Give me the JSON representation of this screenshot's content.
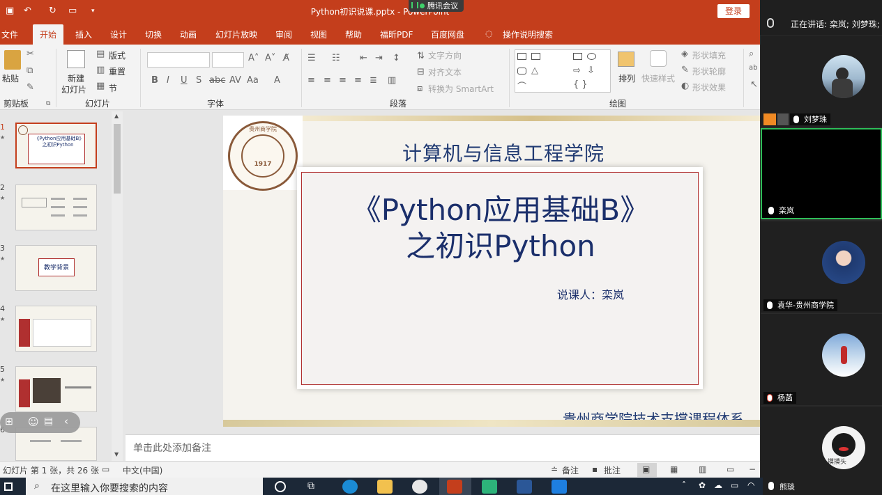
{
  "window": {
    "title": "Python初识说课.pptx - PowerPoint",
    "login_label": "登录"
  },
  "tencent_meeting": {
    "badge": "腾讯会议"
  },
  "menu": {
    "tabs": [
      "文件",
      "开始",
      "插入",
      "设计",
      "切换",
      "动画",
      "幻灯片放映",
      "审阅",
      "视图",
      "帮助",
      "福昕PDF",
      "百度网盘"
    ],
    "active_tab": "开始",
    "search_hint": "操作说明搜索"
  },
  "ribbon": {
    "clipboard": {
      "label": "剪贴板",
      "paste": "粘贴"
    },
    "slides": {
      "label": "幻灯片",
      "new_slide": "新建",
      "new_slide2": "幻灯片",
      "layout": "版式",
      "reset": "重置",
      "section": "节"
    },
    "font": {
      "label": "字体"
    },
    "paragraph": {
      "label": "段落",
      "text_direction": "文字方向",
      "align_text": "对齐文本",
      "smartart": "转换为 SmartArt"
    },
    "drawing": {
      "label": "绘图",
      "arrange": "排列",
      "quick_styles": "快速样式",
      "shape_fill": "形状填充",
      "shape_outline": "形状轮廓",
      "shape_effects": "形状效果"
    }
  },
  "thumbnails": {
    "slides": [
      {
        "num": "1",
        "title": "《Python应用基础B》之初识Python"
      },
      {
        "num": "2",
        "title": ""
      },
      {
        "num": "3",
        "title": "教学背景"
      },
      {
        "num": "4",
        "title": ""
      },
      {
        "num": "5",
        "title": ""
      },
      {
        "num": "6",
        "title": ""
      }
    ]
  },
  "slide": {
    "college": "计算机与信息工程学院",
    "title_line1": "《Python应用基础B》",
    "title_line2": "之初识Python",
    "lecturer": "说课人：栾岚",
    "footer": "贵州商学院技术支撑课程体系",
    "logo_year": "1917",
    "logo_text": "贵州商学院"
  },
  "notes": {
    "placeholder": "单击此处添加备注"
  },
  "status": {
    "slide_info": "幻灯片 第 1 张，共 26 张",
    "language": "中文(中国)",
    "notes_btn": "备注",
    "comments_btn": "批注"
  },
  "taskbar": {
    "search_placeholder": "在这里输入你要搜索的内容"
  },
  "meeting": {
    "speaking": "正在讲话: 栾岚; 刘梦珠;",
    "participants": [
      {
        "name": "刘梦珠"
      },
      {
        "name": "栾岚"
      },
      {
        "name": "袁华-贵州商学院"
      },
      {
        "name": "杨菡"
      },
      {
        "name": "熊琰",
        "caption": "摸摸头"
      }
    ]
  },
  "colors": {
    "accent": "#c43e1c",
    "slide_blue": "#1b2f6b",
    "meeting_green": "#2ebd59"
  }
}
